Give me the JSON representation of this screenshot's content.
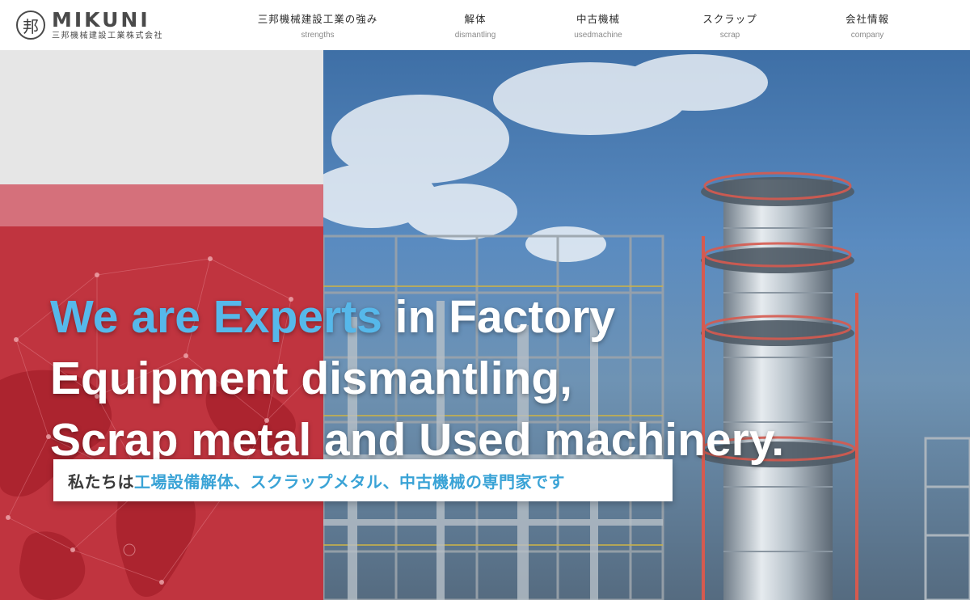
{
  "header": {
    "logo": {
      "mark": "邦",
      "name": "MIKUNI",
      "subtitle": "三邦機械建設工業株式会社"
    },
    "nav": [
      {
        "jp": "三邦機械建設工業の強み",
        "en": "strengths"
      },
      {
        "jp": "解体",
        "en": "dismantling"
      },
      {
        "jp": "中古機械",
        "en": "usedmachine"
      },
      {
        "jp": "スクラップ",
        "en": "scrap"
      },
      {
        "jp": "会社情報",
        "en": "company"
      }
    ]
  },
  "hero": {
    "headline": {
      "line1_accent": "We are Experts",
      "line1_rest": " in Factory",
      "line2": "Equipment dismantling,",
      "line3": "Scrap metal and Used machinery."
    },
    "subheading": {
      "prefix": "私たちは",
      "accent": "工場設備解体、スクラップメタル、中古機械の専門家です"
    }
  },
  "colors": {
    "accent_blue": "#56b8ea",
    "brand_red": "#c0343f",
    "band_pink": "#d5707b",
    "band_gray": "#e6e6e6",
    "sky_blue": "#3e6fa6"
  }
}
